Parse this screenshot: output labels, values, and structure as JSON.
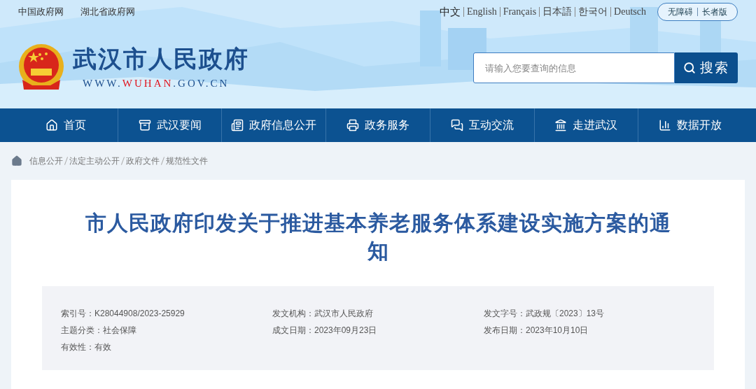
{
  "top_links": [
    "中国政府网",
    "湖北省政府网"
  ],
  "languages": [
    {
      "label": "中文",
      "selected": true
    },
    {
      "label": "English",
      "selected": false
    },
    {
      "label": "Français",
      "selected": false
    },
    {
      "label": "日本語",
      "selected": false
    },
    {
      "label": "한국어",
      "selected": false
    },
    {
      "label": "Deutsch",
      "selected": false
    }
  ],
  "access_buttons": [
    "无障碍",
    "长者版"
  ],
  "site": {
    "title": "武汉市人民政府",
    "url_parts": [
      {
        "text": "WWW.",
        "highlight": false
      },
      {
        "text": "WUHAN",
        "highlight": true
      },
      {
        "text": ".GOV.CN",
        "highlight": false
      }
    ]
  },
  "search": {
    "placeholder": "请输入您要查询的信息",
    "button": "搜索"
  },
  "nav": [
    {
      "label": "首页"
    },
    {
      "label": "武汉要闻"
    },
    {
      "label": "政府信息公开"
    },
    {
      "label": "政务服务"
    },
    {
      "label": "互动交流"
    },
    {
      "label": "走进武汉"
    },
    {
      "label": "数据开放"
    }
  ],
  "breadcrumb": [
    "信息公开",
    "法定主动公开",
    "政府文件",
    "规范性文件"
  ],
  "article": {
    "title": "市人民政府印发关于推进基本养老服务体系建设实施方案的通知",
    "meta": [
      {
        "label": "索引号：",
        "value": "K28044908/2023-25929"
      },
      {
        "label": "发文机构：",
        "value": "武汉市人民政府"
      },
      {
        "label": "发文字号：",
        "value": "武政规〔2023〕13号"
      },
      {
        "label": "主题分类：",
        "value": "社会保障"
      },
      {
        "label": "成文日期：",
        "value": "2023年09月23日"
      },
      {
        "label": "发布日期：",
        "value": "2023年10月10日"
      },
      {
        "label": "有效性：",
        "value": "有效"
      }
    ]
  }
}
